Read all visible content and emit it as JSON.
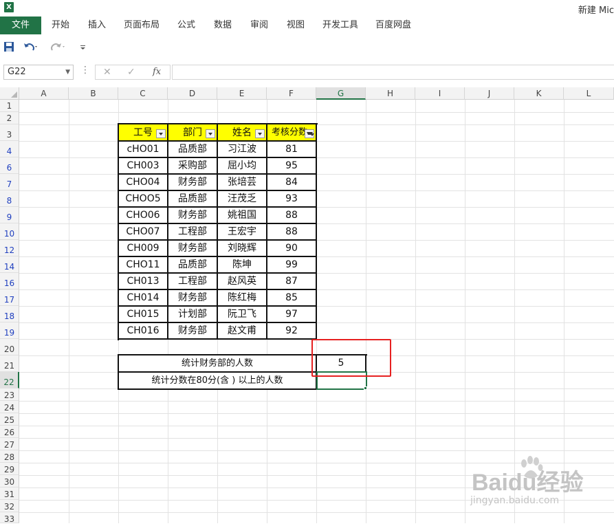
{
  "window": {
    "title": "新建 Mic"
  },
  "ribbon": {
    "tabs": [
      {
        "label": "文件"
      },
      {
        "label": "开始"
      },
      {
        "label": "插入"
      },
      {
        "label": "页面布局"
      },
      {
        "label": "公式"
      },
      {
        "label": "数据"
      },
      {
        "label": "审阅"
      },
      {
        "label": "视图"
      },
      {
        "label": "开发工具"
      },
      {
        "label": "百度网盘"
      }
    ]
  },
  "quick_access": {
    "icons": [
      "save-icon",
      "undo-icon",
      "redo-icon",
      "customize-icon"
    ]
  },
  "formula_bar": {
    "name_box": "G22",
    "fx_label": "fx",
    "value": ""
  },
  "columns": [
    "A",
    "B",
    "C",
    "D",
    "E",
    "F",
    "G",
    "H",
    "I",
    "J",
    "K",
    "L"
  ],
  "active_column": "G",
  "rows": [
    "1",
    "2",
    "3",
    "4",
    "6",
    "7",
    "8",
    "9",
    "10",
    "12",
    "14",
    "16",
    "17",
    "18",
    "19",
    "20",
    "21",
    "22",
    "23",
    "24",
    "25",
    "26",
    "27",
    "28",
    "29",
    "30",
    "31",
    "32",
    "33"
  ],
  "active_row": "22",
  "table": {
    "headers": [
      "工号",
      "部门",
      "姓名",
      "考核分数"
    ],
    "filtered_column": "考核分数",
    "rows": [
      [
        "cHO01",
        "品质部",
        "习江波",
        "81"
      ],
      [
        "CH003",
        "采购部",
        "屈小均",
        "95"
      ],
      [
        "CHO04",
        "财务部",
        "张培芸",
        "84"
      ],
      [
        "CHOO5",
        "品质部",
        "汪茂乏",
        "93"
      ],
      [
        "CHO06",
        "财务部",
        "姚祖国",
        "88"
      ],
      [
        "CHO07",
        "工程部",
        "王宏宇",
        "88"
      ],
      [
        "CH009",
        "财务部",
        "刘晓辉",
        "90"
      ],
      [
        "CHO11",
        "品质部",
        "陈坤",
        "99"
      ],
      [
        "CH013",
        "工程部",
        "赵风英",
        "87"
      ],
      [
        "CH014",
        "财务部",
        "陈红梅",
        "85"
      ],
      [
        "CH015",
        "计划部",
        "阮卫飞",
        "97"
      ],
      [
        "CH016",
        "财务部",
        "赵文甫",
        "92"
      ]
    ]
  },
  "summary": [
    {
      "label": "统计财务部的人数",
      "value": "5"
    },
    {
      "label": "统计分数在80分(含 ) 以上的人数",
      "value": ""
    }
  ],
  "watermark": {
    "main": "Baidu经验",
    "sub": "jingyan.baidu.com"
  },
  "colors": {
    "excel_green": "#217346",
    "header_yellow": "#ffff00",
    "highlight_red": "#e62020"
  }
}
